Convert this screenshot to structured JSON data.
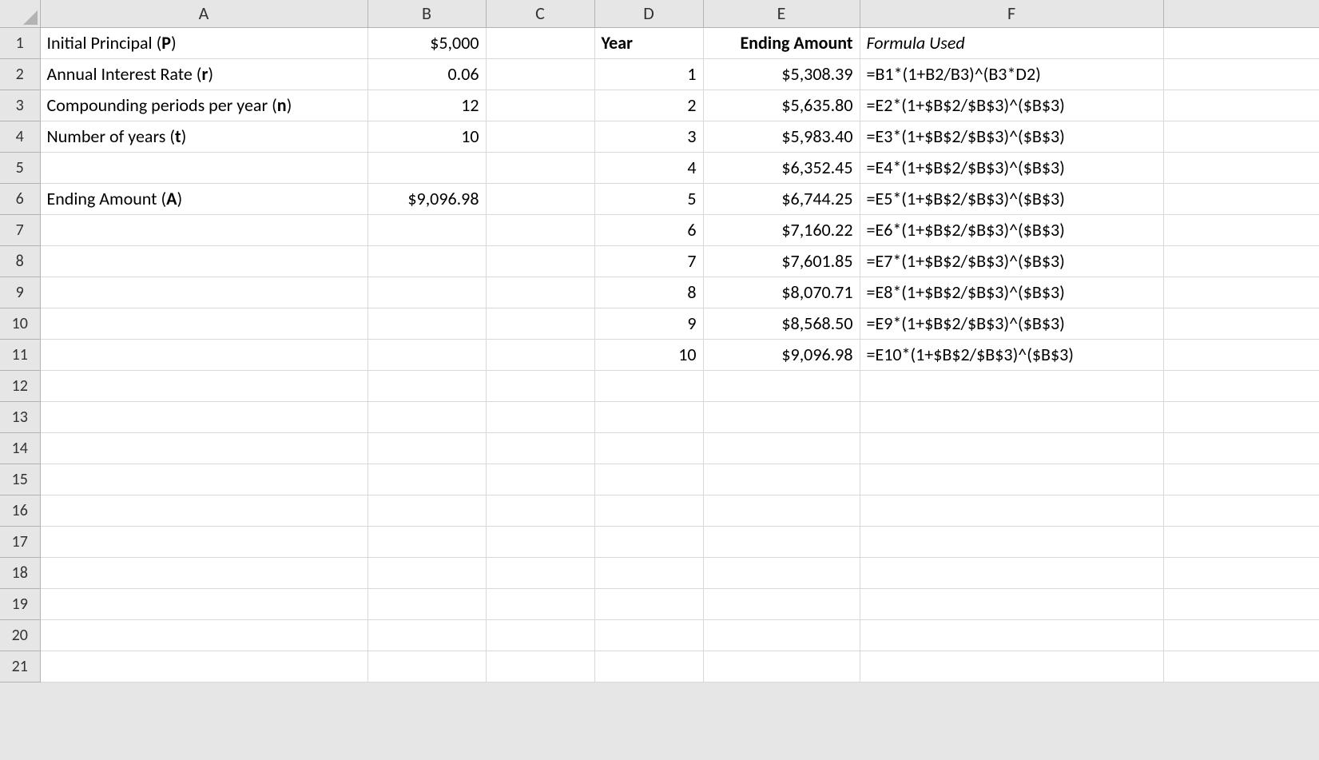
{
  "columns": [
    "A",
    "B",
    "C",
    "D",
    "E",
    "F"
  ],
  "row_headers": [
    "1",
    "2",
    "3",
    "4",
    "5",
    "6",
    "7",
    "8",
    "9",
    "10",
    "11",
    "12",
    "13",
    "14",
    "15",
    "16",
    "17",
    "18",
    "19",
    "20",
    "21"
  ],
  "inputs": {
    "principal": {
      "label_pre": "Initial Principal (",
      "var": "P",
      "label_post": ")",
      "value": "$5,000"
    },
    "rate": {
      "label_pre": "Annual Interest Rate (",
      "var": "r",
      "label_post": ")",
      "value": "0.06"
    },
    "periods": {
      "label_pre": "Compounding periods per year (",
      "var": "n",
      "label_post": ")",
      "value": "12"
    },
    "years": {
      "label_pre": "Number of years (",
      "var": "t",
      "label_post": ")",
      "value": "10"
    },
    "ending": {
      "label_pre": "Ending Amount (",
      "var": "A",
      "label_post": ")",
      "value": "$9,096.98"
    }
  },
  "table": {
    "headers": {
      "year": "Year",
      "amount": "Ending Amount",
      "formula": "Formula Used"
    },
    "rows": [
      {
        "year": "1",
        "amount": "$5,308.39",
        "formula": "=B1*(1+B2/B3)^(B3*D2)"
      },
      {
        "year": "2",
        "amount": "$5,635.80",
        "formula": "=E2*(1+$B$2/$B$3)^($B$3)"
      },
      {
        "year": "3",
        "amount": "$5,983.40",
        "formula": "=E3*(1+$B$2/$B$3)^($B$3)"
      },
      {
        "year": "4",
        "amount": "$6,352.45",
        "formula": "=E4*(1+$B$2/$B$3)^($B$3)"
      },
      {
        "year": "5",
        "amount": "$6,744.25",
        "formula": "=E5*(1+$B$2/$B$3)^($B$3)"
      },
      {
        "year": "6",
        "amount": "$7,160.22",
        "formula": "=E6*(1+$B$2/$B$3)^($B$3)"
      },
      {
        "year": "7",
        "amount": "$7,601.85",
        "formula": "=E7*(1+$B$2/$B$3)^($B$3)"
      },
      {
        "year": "8",
        "amount": "$8,070.71",
        "formula": "=E8*(1+$B$2/$B$3)^($B$3)"
      },
      {
        "year": "9",
        "amount": "$8,568.50",
        "formula": "=E9*(1+$B$2/$B$3)^($B$3)"
      },
      {
        "year": "10",
        "amount": "$9,096.98",
        "formula": "=E10*(1+$B$2/$B$3)^($B$3)"
      }
    ]
  }
}
